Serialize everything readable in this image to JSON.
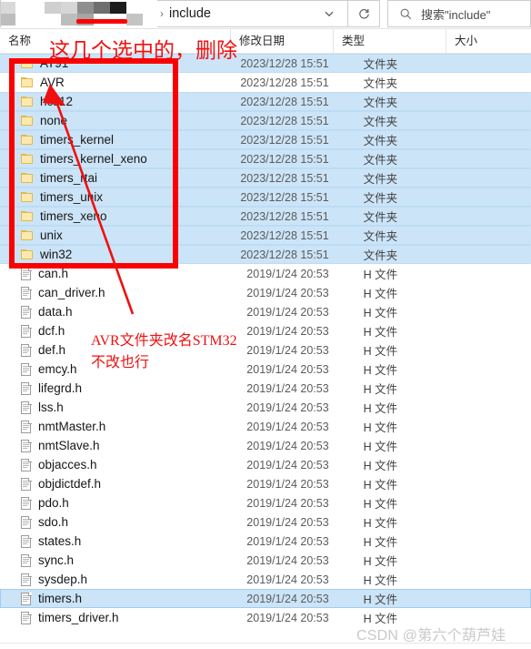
{
  "window": {
    "address": {
      "breadcrumb_separator": "›",
      "current_folder": "include",
      "blurred_path_label": "blurred-path-mosaic"
    },
    "dropdown_icon": "chevron-down-icon",
    "refresh_icon": "refresh-icon",
    "search": {
      "icon": "search-icon",
      "placeholder": "搜索\"include\"",
      "value": ""
    }
  },
  "columns": {
    "name": "名称",
    "date_modified": "修改日期",
    "type": "类型",
    "size": "大小"
  },
  "items": [
    {
      "name": "AT91",
      "date": "2023/12/28 15:51",
      "type": "文件夹",
      "size": "",
      "kind": "folder",
      "state": "selected"
    },
    {
      "name": "AVR",
      "date": "2023/12/28 15:51",
      "type": "文件夹",
      "size": "",
      "kind": "folder",
      "state": "normal"
    },
    {
      "name": "hcs12",
      "date": "2023/12/28 15:51",
      "type": "文件夹",
      "size": "",
      "kind": "folder",
      "state": "selected"
    },
    {
      "name": "none",
      "date": "2023/12/28 15:51",
      "type": "文件夹",
      "size": "",
      "kind": "folder",
      "state": "selected"
    },
    {
      "name": "timers_kernel",
      "date": "2023/12/28 15:51",
      "type": "文件夹",
      "size": "",
      "kind": "folder",
      "state": "selected"
    },
    {
      "name": "timers_kernel_xeno",
      "date": "2023/12/28 15:51",
      "type": "文件夹",
      "size": "",
      "kind": "folder",
      "state": "selected"
    },
    {
      "name": "timers_rtai",
      "date": "2023/12/28 15:51",
      "type": "文件夹",
      "size": "",
      "kind": "folder",
      "state": "selected"
    },
    {
      "name": "timers_unix",
      "date": "2023/12/28 15:51",
      "type": "文件夹",
      "size": "",
      "kind": "folder",
      "state": "selected"
    },
    {
      "name": "timers_xeno",
      "date": "2023/12/28 15:51",
      "type": "文件夹",
      "size": "",
      "kind": "folder",
      "state": "selected"
    },
    {
      "name": "unix",
      "date": "2023/12/28 15:51",
      "type": "文件夹",
      "size": "",
      "kind": "folder",
      "state": "selected"
    },
    {
      "name": "win32",
      "date": "2023/12/28 15:51",
      "type": "文件夹",
      "size": "",
      "kind": "folder",
      "state": "selected"
    },
    {
      "name": "can.h",
      "date": "2019/1/24 20:53",
      "type": "H 文件",
      "size": "",
      "kind": "file",
      "state": "normal"
    },
    {
      "name": "can_driver.h",
      "date": "2019/1/24 20:53",
      "type": "H 文件",
      "size": "",
      "kind": "file",
      "state": "normal"
    },
    {
      "name": "data.h",
      "date": "2019/1/24 20:53",
      "type": "H 文件",
      "size": "",
      "kind": "file",
      "state": "normal"
    },
    {
      "name": "dcf.h",
      "date": "2019/1/24 20:53",
      "type": "H 文件",
      "size": "",
      "kind": "file",
      "state": "normal"
    },
    {
      "name": "def.h",
      "date": "2019/1/24 20:53",
      "type": "H 文件",
      "size": "",
      "kind": "file",
      "state": "normal"
    },
    {
      "name": "emcy.h",
      "date": "2019/1/24 20:53",
      "type": "H 文件",
      "size": "",
      "kind": "file",
      "state": "normal"
    },
    {
      "name": "lifegrd.h",
      "date": "2019/1/24 20:53",
      "type": "H 文件",
      "size": "",
      "kind": "file",
      "state": "normal"
    },
    {
      "name": "lss.h",
      "date": "2019/1/24 20:53",
      "type": "H 文件",
      "size": "",
      "kind": "file",
      "state": "normal"
    },
    {
      "name": "nmtMaster.h",
      "date": "2019/1/24 20:53",
      "type": "H 文件",
      "size": "",
      "kind": "file",
      "state": "normal"
    },
    {
      "name": "nmtSlave.h",
      "date": "2019/1/24 20:53",
      "type": "H 文件",
      "size": "",
      "kind": "file",
      "state": "normal"
    },
    {
      "name": "objacces.h",
      "date": "2019/1/24 20:53",
      "type": "H 文件",
      "size": "",
      "kind": "file",
      "state": "normal"
    },
    {
      "name": "objdictdef.h",
      "date": "2019/1/24 20:53",
      "type": "H 文件",
      "size": "",
      "kind": "file",
      "state": "normal"
    },
    {
      "name": "pdo.h",
      "date": "2019/1/24 20:53",
      "type": "H 文件",
      "size": "",
      "kind": "file",
      "state": "normal"
    },
    {
      "name": "sdo.h",
      "date": "2019/1/24 20:53",
      "type": "H 文件",
      "size": "",
      "kind": "file",
      "state": "normal"
    },
    {
      "name": "states.h",
      "date": "2019/1/24 20:53",
      "type": "H 文件",
      "size": "",
      "kind": "file",
      "state": "normal"
    },
    {
      "name": "sync.h",
      "date": "2019/1/24 20:53",
      "type": "H 文件",
      "size": "",
      "kind": "file",
      "state": "normal"
    },
    {
      "name": "sysdep.h",
      "date": "2019/1/24 20:53",
      "type": "H 文件",
      "size": "",
      "kind": "file",
      "state": "normal"
    },
    {
      "name": "timers.h",
      "date": "2019/1/24 20:53",
      "type": "H 文件",
      "size": "",
      "kind": "file",
      "state": "focused"
    },
    {
      "name": "timers_driver.h",
      "date": "2019/1/24 20:53",
      "type": "H 文件",
      "size": "",
      "kind": "file",
      "state": "normal"
    }
  ],
  "annotations": {
    "header_note": "这几个选中的，删除",
    "mid_note_line1": "AVR文件夹改名STM32",
    "mid_note_line2": "不改也行",
    "color": "#f01010"
  },
  "watermark": "CSDN @第六个葫芦娃"
}
